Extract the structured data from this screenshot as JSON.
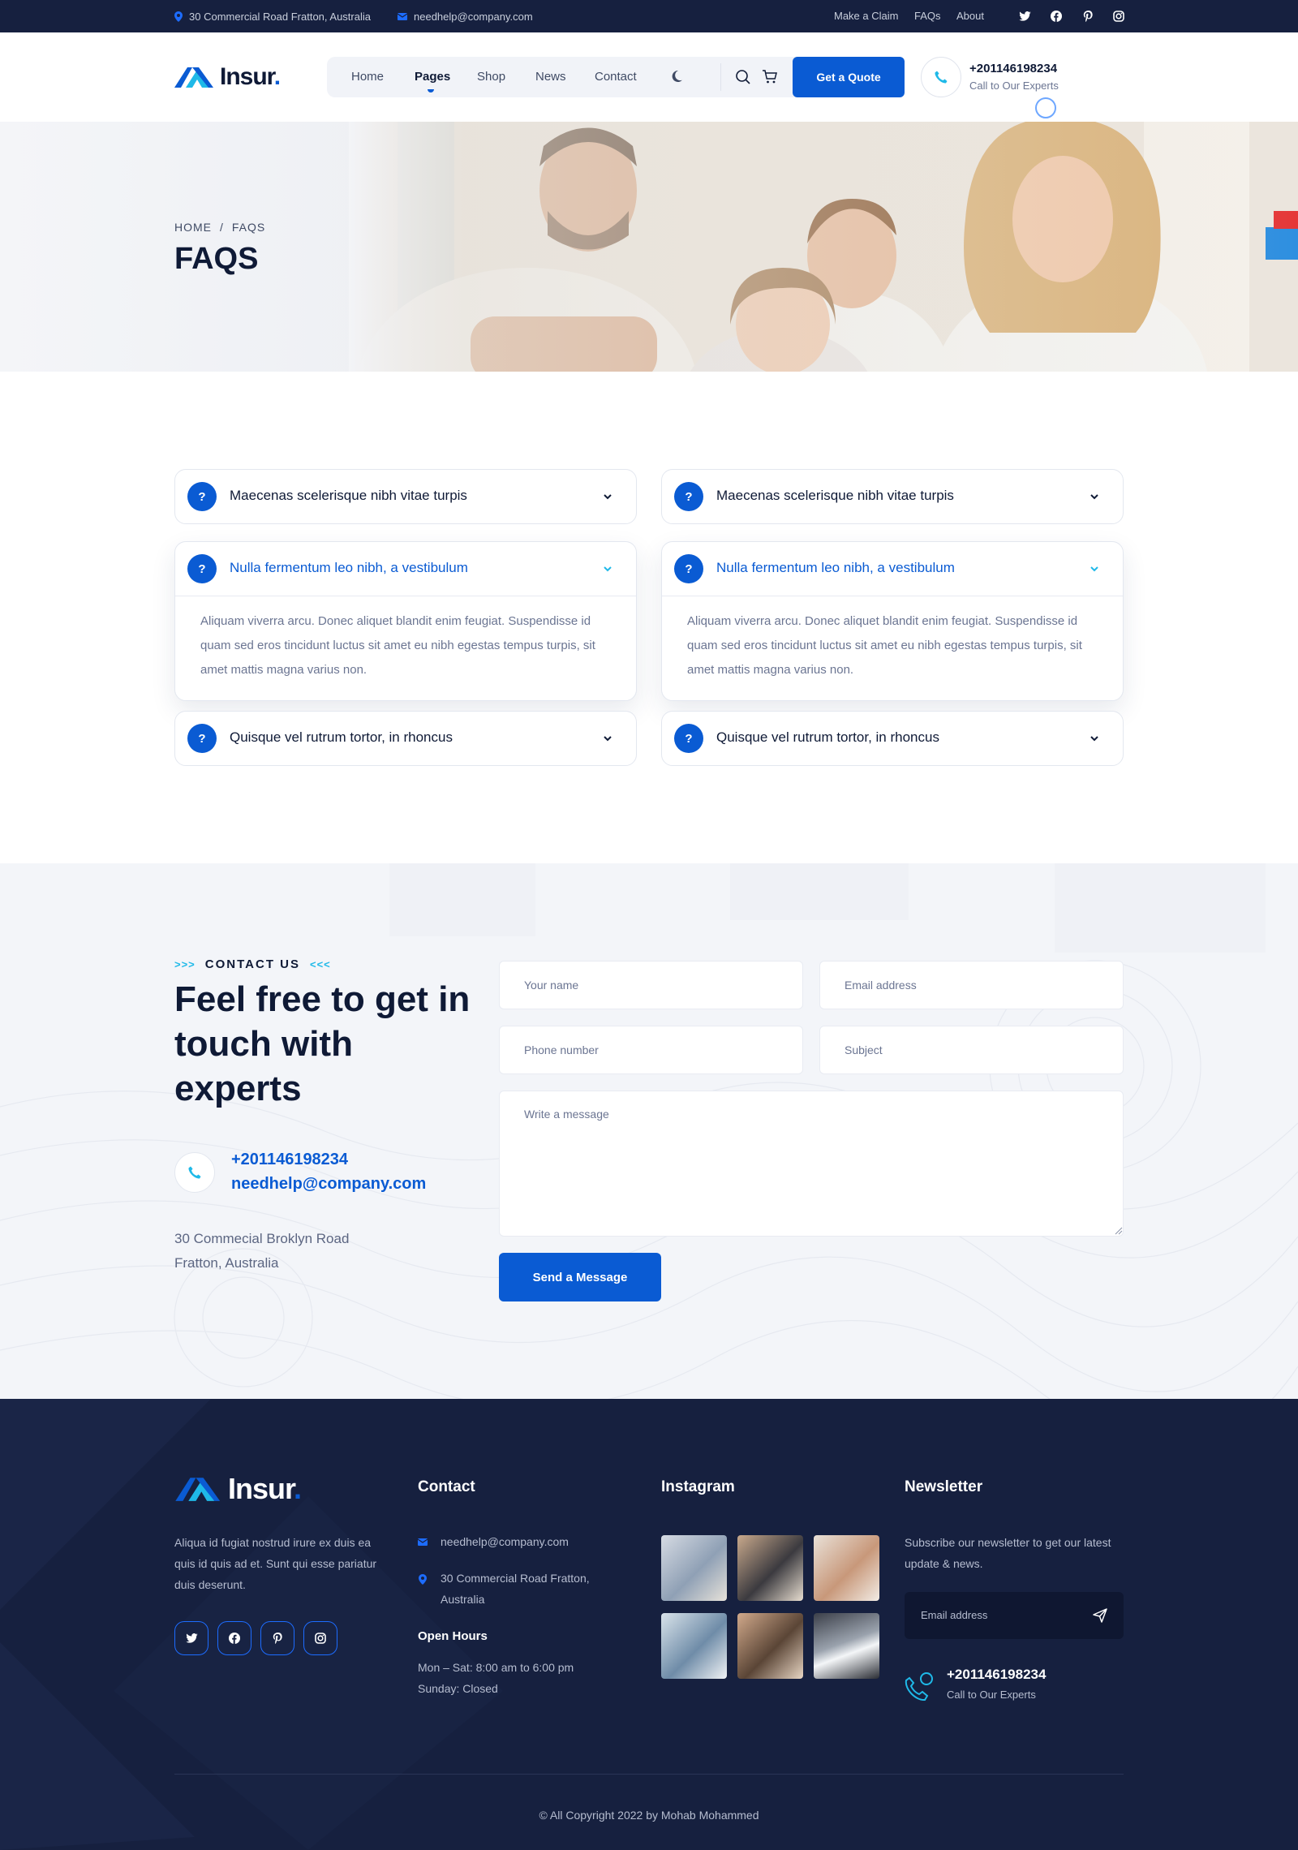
{
  "topbar": {
    "address": "30 Commercial Road Fratton, Australia",
    "email": "needhelp@company.com",
    "links": [
      "Make a Claim",
      "FAQs",
      "About"
    ],
    "social": [
      "twitter-icon",
      "facebook-icon",
      "pinterest-icon",
      "instagram-icon"
    ]
  },
  "header": {
    "logo": "Insur",
    "logo_dot": ".",
    "nav": [
      "Home",
      "Pages",
      "Shop",
      "News",
      "Contact"
    ],
    "active_nav": "Pages",
    "quote_button": "Get a Quote",
    "phone": "+201146198234",
    "phone_sub": "Call to Our Experts"
  },
  "hero": {
    "crumb_home": "HOME",
    "crumb_sep": "/",
    "crumb_current": "FAQS",
    "title": "FAQS"
  },
  "faq": {
    "left": [
      {
        "title": "Maecenas scelerisque nibh vitae turpis",
        "open": false
      },
      {
        "title": "Nulla fermentum leo nibh, a vestibulum",
        "open": true,
        "answer": "Aliquam viverra arcu. Donec aliquet blandit enim feugiat. Suspendisse id quam sed eros tincidunt luctus sit amet eu nibh egestas tempus turpis, sit amet mattis magna varius non."
      },
      {
        "title": "Quisque vel rutrum tortor, in rhoncus",
        "open": false
      }
    ],
    "right": [
      {
        "title": "Maecenas scelerisque nibh vitae turpis",
        "open": false
      },
      {
        "title": "Nulla fermentum leo nibh, a vestibulum",
        "open": true,
        "answer": "Aliquam viverra arcu. Donec aliquet blandit enim feugiat. Suspendisse id quam sed eros tincidunt luctus sit amet eu nibh egestas tempus turpis, sit amet mattis magna varius non."
      },
      {
        "title": "Quisque vel rutrum tortor, in rhoncus",
        "open": false
      }
    ],
    "q_mark": "?"
  },
  "contact": {
    "tag": "CONTACT US",
    "tag_left": ">>>",
    "tag_right": "<<<",
    "heading": "Feel free to get in touch with experts",
    "phone": "+201146198234",
    "email": "needhelp@company.com",
    "address_line1": "30 Commecial Broklyn Road",
    "address_line2": "Fratton, Australia",
    "form": {
      "name": "Your name",
      "email": "Email address",
      "phone": "Phone number",
      "subject": "Subject",
      "message": "Write a message",
      "submit": "Send a Message"
    }
  },
  "footer": {
    "logo": "Insur",
    "logo_dot": ".",
    "about": "Aliqua id fugiat nostrud irure ex duis ea quis id quis ad et. Sunt qui esse pariatur duis deserunt.",
    "contact_title": "Contact",
    "contact_email": "needhelp@company.com",
    "contact_address": "30 Commercial Road Fratton, Australia",
    "hours_title": "Open Hours",
    "hours_weekday": "Mon – Sat: 8:00 am to 6:00 pm",
    "hours_sunday": "Sunday: Closed",
    "instagram_title": "Instagram",
    "newsletter_title": "Newsletter",
    "newsletter_text": "Subscribe our newsletter to get our latest update & news.",
    "newsletter_placeholder": "Email address",
    "phone": "+201146198234",
    "phone_sub": "Call to Our Experts",
    "copyright": "© All Copyright 2022 by Mohab Mohammed"
  },
  "colors": {
    "primary": "#0a5bd3",
    "navy": "#16203f",
    "accent": "#1fb9e8"
  }
}
